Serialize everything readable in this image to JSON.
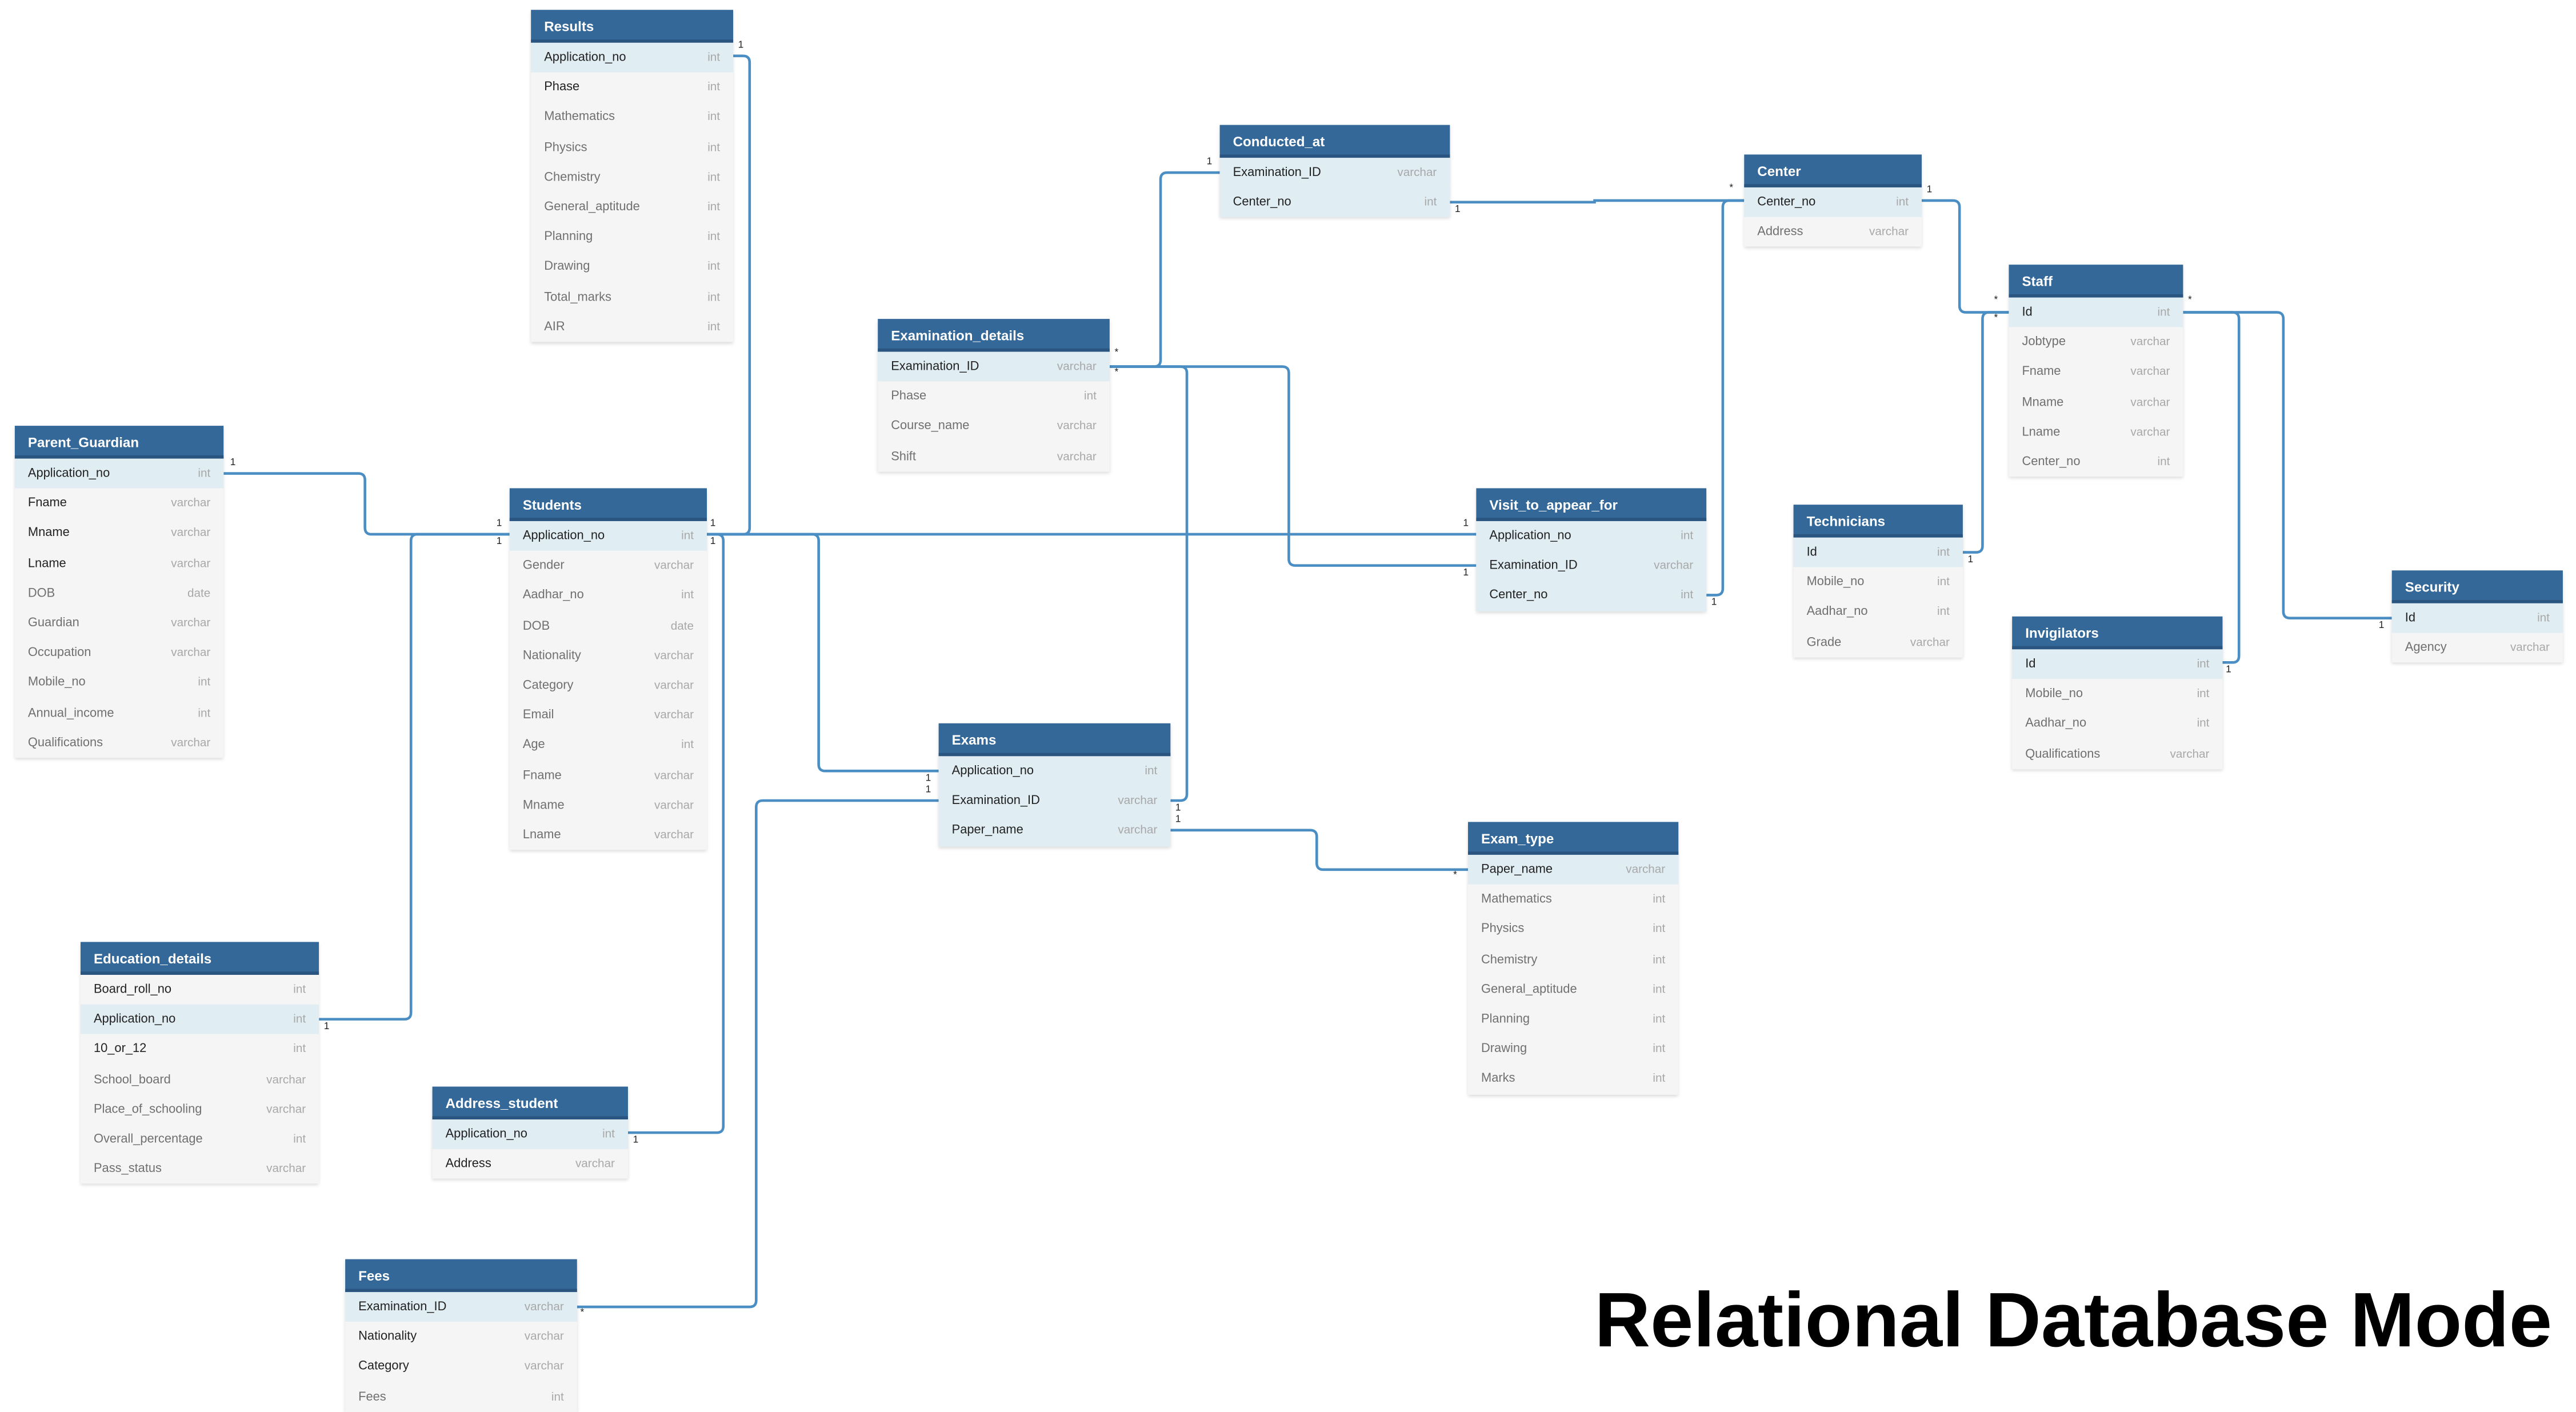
{
  "heading": "Relational Database Mode",
  "colors": {
    "header": "#336898",
    "keyRow": "#e0edf2",
    "body": "#f5f5f5",
    "link": "#4a8ec3"
  },
  "tables": {
    "results": {
      "title": "Results",
      "fields": [
        {
          "name": "Application_no",
          "type": "int",
          "key": true
        },
        {
          "name": "Phase",
          "type": "int",
          "dark": true
        },
        {
          "name": "Mathematics",
          "type": "int"
        },
        {
          "name": "Physics",
          "type": "int"
        },
        {
          "name": "Chemistry",
          "type": "int"
        },
        {
          "name": "General_aptitude",
          "type": "int"
        },
        {
          "name": "Planning",
          "type": "int"
        },
        {
          "name": "Drawing",
          "type": "int"
        },
        {
          "name": "Total_marks",
          "type": "int"
        },
        {
          "name": "AIR",
          "type": "int"
        }
      ]
    },
    "conducted_at": {
      "title": "Conducted_at",
      "fields": [
        {
          "name": "Examination_ID",
          "type": "varchar",
          "key": true
        },
        {
          "name": "Center_no",
          "type": "int",
          "key": true
        }
      ]
    },
    "center": {
      "title": "Center",
      "fields": [
        {
          "name": "Center_no",
          "type": "int",
          "key": true
        },
        {
          "name": "Address",
          "type": "varchar"
        }
      ]
    },
    "staff": {
      "title": "Staff",
      "fields": [
        {
          "name": "Id",
          "type": "int",
          "key": true
        },
        {
          "name": "Jobtype",
          "type": "varchar"
        },
        {
          "name": "Fname",
          "type": "varchar"
        },
        {
          "name": "Mname",
          "type": "varchar"
        },
        {
          "name": "Lname",
          "type": "varchar"
        },
        {
          "name": "Center_no",
          "type": "int"
        }
      ]
    },
    "examination_details": {
      "title": "Examination_details",
      "fields": [
        {
          "name": "Examination_ID",
          "type": "varchar",
          "key": true
        },
        {
          "name": "Phase",
          "type": "int"
        },
        {
          "name": "Course_name",
          "type": "varchar"
        },
        {
          "name": "Shift",
          "type": "varchar"
        }
      ]
    },
    "parent_guardian": {
      "title": "Parent_Guardian",
      "fields": [
        {
          "name": "Application_no",
          "type": "int",
          "key": true
        },
        {
          "name": "Fname",
          "type": "varchar",
          "dark": true
        },
        {
          "name": "Mname",
          "type": "varchar",
          "dark": true
        },
        {
          "name": "Lname",
          "type": "varchar",
          "dark": true
        },
        {
          "name": "DOB",
          "type": "date"
        },
        {
          "name": "Guardian",
          "type": "varchar"
        },
        {
          "name": "Occupation",
          "type": "varchar"
        },
        {
          "name": "Mobile_no",
          "type": "int"
        },
        {
          "name": "Annual_income",
          "type": "int"
        },
        {
          "name": "Qualifications",
          "type": "varchar"
        }
      ]
    },
    "students": {
      "title": "Students",
      "fields": [
        {
          "name": "Application_no",
          "type": "int",
          "key": true
        },
        {
          "name": "Gender",
          "type": "varchar"
        },
        {
          "name": "Aadhar_no",
          "type": "int"
        },
        {
          "name": "DOB",
          "type": "date"
        },
        {
          "name": "Nationality",
          "type": "varchar"
        },
        {
          "name": "Category",
          "type": "varchar"
        },
        {
          "name": "Email",
          "type": "varchar"
        },
        {
          "name": "Age",
          "type": "int"
        },
        {
          "name": "Fname",
          "type": "varchar"
        },
        {
          "name": "Mname",
          "type": "varchar"
        },
        {
          "name": "Lname",
          "type": "varchar"
        }
      ]
    },
    "visit_to_appear_for": {
      "title": "Visit_to_appear_for",
      "fields": [
        {
          "name": "Application_no",
          "type": "int",
          "key": true
        },
        {
          "name": "Examination_ID",
          "type": "varchar",
          "key": true
        },
        {
          "name": "Center_no",
          "type": "int",
          "key": true
        }
      ]
    },
    "technicians": {
      "title": "Technicians",
      "fields": [
        {
          "name": "Id",
          "type": "int",
          "key": true
        },
        {
          "name": "Mobile_no",
          "type": "int"
        },
        {
          "name": "Aadhar_no",
          "type": "int"
        },
        {
          "name": "Grade",
          "type": "varchar"
        }
      ]
    },
    "security": {
      "title": "Security",
      "fields": [
        {
          "name": "Id",
          "type": "int",
          "key": true
        },
        {
          "name": "Agency",
          "type": "varchar"
        }
      ]
    },
    "invigilators": {
      "title": "Invigilators",
      "fields": [
        {
          "name": "Id",
          "type": "int",
          "key": true
        },
        {
          "name": "Mobile_no",
          "type": "int"
        },
        {
          "name": "Aadhar_no",
          "type": "int"
        },
        {
          "name": "Qualifications",
          "type": "varchar"
        }
      ]
    },
    "exams": {
      "title": "Exams",
      "fields": [
        {
          "name": "Application_no",
          "type": "int",
          "key": true
        },
        {
          "name": "Examination_ID",
          "type": "varchar",
          "key": true
        },
        {
          "name": "Paper_name",
          "type": "varchar",
          "key": true
        }
      ]
    },
    "exam_type": {
      "title": "Exam_type",
      "fields": [
        {
          "name": "Paper_name",
          "type": "varchar",
          "key": true
        },
        {
          "name": "Mathematics",
          "type": "int"
        },
        {
          "name": "Physics",
          "type": "int"
        },
        {
          "name": "Chemistry",
          "type": "int"
        },
        {
          "name": "General_aptitude",
          "type": "int"
        },
        {
          "name": "Planning",
          "type": "int"
        },
        {
          "name": "Drawing",
          "type": "int"
        },
        {
          "name": "Marks",
          "type": "int"
        }
      ]
    },
    "education_details": {
      "title": "Education_details",
      "fields": [
        {
          "name": "Board_roll_no",
          "type": "int",
          "dark": true
        },
        {
          "name": "Application_no",
          "type": "int",
          "key": true
        },
        {
          "name": "10_or_12",
          "type": "int",
          "dark": true
        },
        {
          "name": "School_board",
          "type": "varchar"
        },
        {
          "name": "Place_of_schooling",
          "type": "varchar"
        },
        {
          "name": "Overall_percentage",
          "type": "int"
        },
        {
          "name": "Pass_status",
          "type": "varchar"
        }
      ]
    },
    "address_student": {
      "title": "Address_student",
      "fields": [
        {
          "name": "Application_no",
          "type": "int",
          "key": true
        },
        {
          "name": "Address",
          "type": "varchar",
          "dark": true
        }
      ]
    },
    "fees": {
      "title": "Fees",
      "fields": [
        {
          "name": "Examination_ID",
          "type": "varchar",
          "key": true
        },
        {
          "name": "Nationality",
          "type": "varchar",
          "dark": true
        },
        {
          "name": "Category",
          "type": "varchar",
          "dark": true
        },
        {
          "name": "Fees",
          "type": "int"
        }
      ]
    }
  },
  "cardinality": {
    "one": "1",
    "many": "*"
  }
}
